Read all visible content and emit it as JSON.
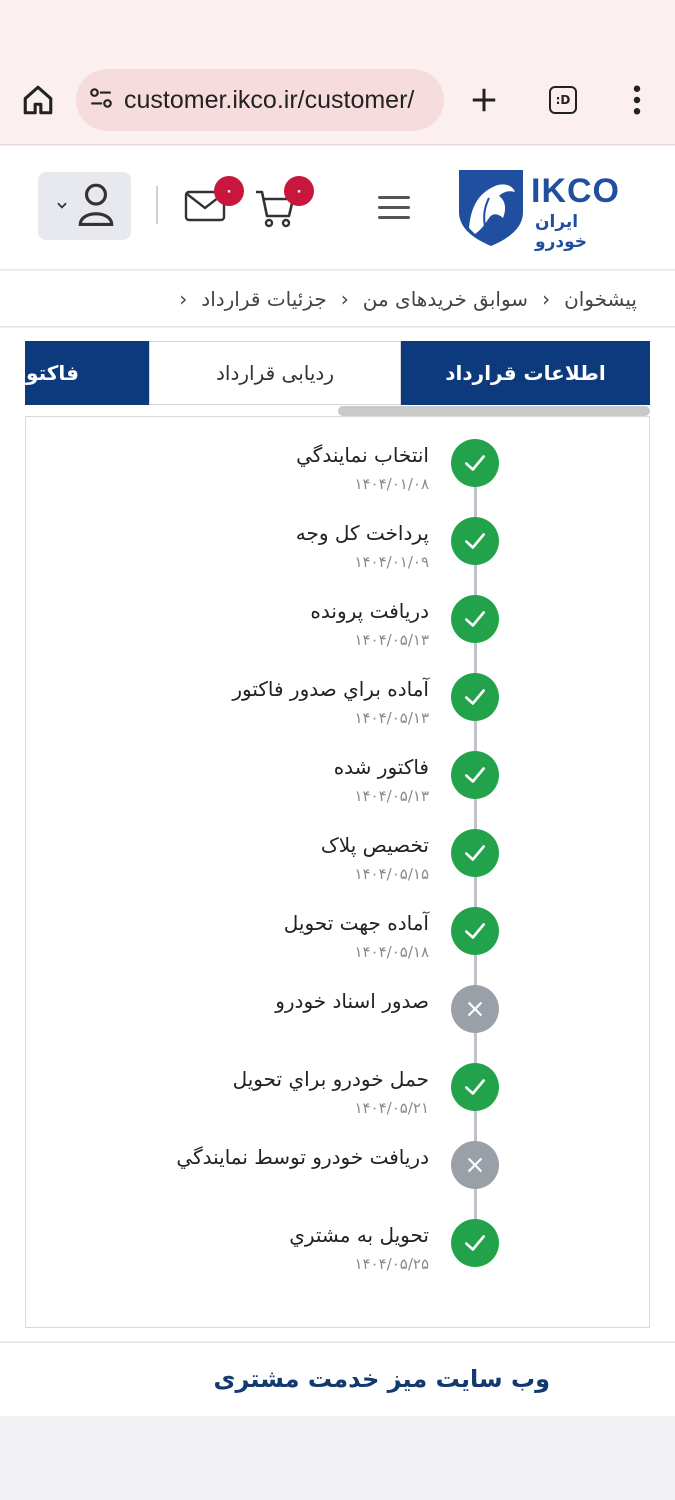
{
  "browser": {
    "url": "customer.ikco.ir/customer/",
    "tab_switcher_label": ":D"
  },
  "header": {
    "cart_badge": "۰",
    "messages_badge": "۰",
    "logo_text": "IKCO",
    "logo_subtext": "ایران خودرو"
  },
  "breadcrumb": {
    "items": [
      "پیشخوان",
      "سوابق خریدهای من",
      "جزئیات قرارداد"
    ],
    "separator": "›"
  },
  "tabs": {
    "contract_info": "اطلاعات قرارداد",
    "contract_tracking": "ردیابی قرارداد",
    "invoice": "فاکتور"
  },
  "colors": {
    "brand_blue": "#0c3a7c",
    "done_green": "#22a24a",
    "fail_gray": "#9aa0a8",
    "badge_red": "#c8163c"
  },
  "steps": [
    {
      "title": "انتخاب نمايندگي",
      "date": "۱۴۰۴/۰۱/۰۸",
      "status": "done"
    },
    {
      "title": "پرداخت کل وجه",
      "date": "۱۴۰۴/۰۱/۰۹",
      "status": "done"
    },
    {
      "title": "دريافت پرونده",
      "date": "۱۴۰۴/۰۵/۱۳",
      "status": "done"
    },
    {
      "title": "آماده براي صدور فاکتور",
      "date": "۱۴۰۴/۰۵/۱۳",
      "status": "done"
    },
    {
      "title": "فاکتور شده",
      "date": "۱۴۰۴/۰۵/۱۳",
      "status": "done"
    },
    {
      "title": "تخصيص پلاک",
      "date": "۱۴۰۴/۰۵/۱۵",
      "status": "done"
    },
    {
      "title": "آماده جهت تحويل",
      "date": "۱۴۰۴/۰۵/۱۸",
      "status": "done"
    },
    {
      "title": "صدور اسناد خودرو",
      "date": "",
      "status": "fail"
    },
    {
      "title": "حمل خودرو براي تحويل",
      "date": "۱۴۰۴/۰۵/۲۱",
      "status": "done"
    },
    {
      "title": "دريافت خودرو توسط نمايندگي",
      "date": "",
      "status": "fail"
    },
    {
      "title": "تحويل به مشتري",
      "date": "۱۴۰۴/۰۵/۲۵",
      "status": "done"
    }
  ],
  "footer": {
    "link": "وب سایت میز خدمت مشتری"
  }
}
